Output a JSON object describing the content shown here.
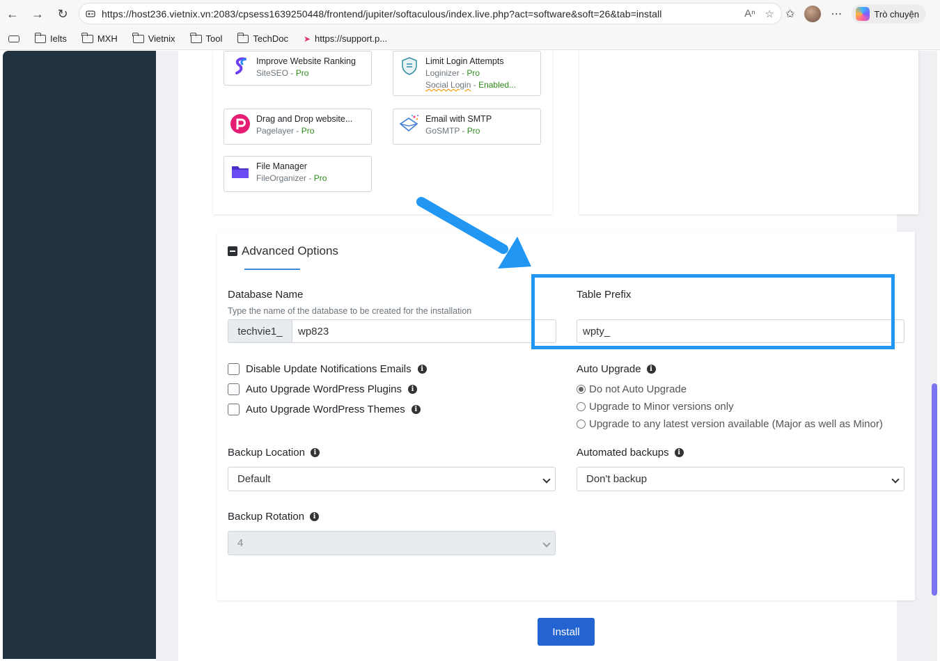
{
  "browser": {
    "url": "https://host236.vietnix.vn:2083/cpsess1639250448/frontend/jupiter/softaculous/index.live.php?act=software&soft=26&tab=install",
    "copilot_label": "Trò chuyện",
    "bookmarks": [
      "Ielts",
      "MXH",
      "Vietnix",
      "Tool",
      "TechDoc",
      "https://support.p..."
    ]
  },
  "plugins": [
    {
      "name": "Improve Website Ranking",
      "vendor": "SiteSEO",
      "tier": "Pro"
    },
    {
      "name": "Limit Login Attempts",
      "vendor": "Loginizer",
      "tier": "Pro",
      "extra_label": "Social Login",
      "extra_status": "Enabled..."
    },
    {
      "name": "Drag and Drop website...",
      "vendor": "Pagelayer",
      "tier": "Pro"
    },
    {
      "name": "Email with SMTP",
      "vendor": "GoSMTP",
      "tier": "Pro"
    },
    {
      "name": "File Manager",
      "vendor": "FileOrganizer",
      "tier": "Pro"
    }
  ],
  "advanced": {
    "title": "Advanced Options",
    "database": {
      "label": "Database Name",
      "hint": "Type the name of the database to be created for the installation",
      "prefix": "techvie1_",
      "value": "wp823"
    },
    "table_prefix": {
      "label": "Table Prefix",
      "value": "wpty_"
    },
    "checkboxes": [
      {
        "label": "Disable Update Notifications Emails",
        "checked": false
      },
      {
        "label": "Auto Upgrade WordPress Plugins",
        "checked": false
      },
      {
        "label": "Auto Upgrade WordPress Themes",
        "checked": false
      }
    ],
    "auto_upgrade": {
      "label": "Auto Upgrade",
      "options": [
        "Do not Auto Upgrade",
        "Upgrade to Minor versions only",
        "Upgrade to any latest version available (Major as well as Minor)"
      ],
      "selected": 0
    },
    "backup_location": {
      "label": "Backup Location",
      "value": "Default"
    },
    "automated_backups": {
      "label": "Automated backups",
      "value": "Don't backup"
    },
    "backup_rotation": {
      "label": "Backup Rotation",
      "value": "4"
    }
  },
  "install_label": "Install",
  "colors": {
    "accent": "#2196f3",
    "install": "#2364d2",
    "sidebar": "#22323f",
    "pro": "#2e8b1a"
  }
}
